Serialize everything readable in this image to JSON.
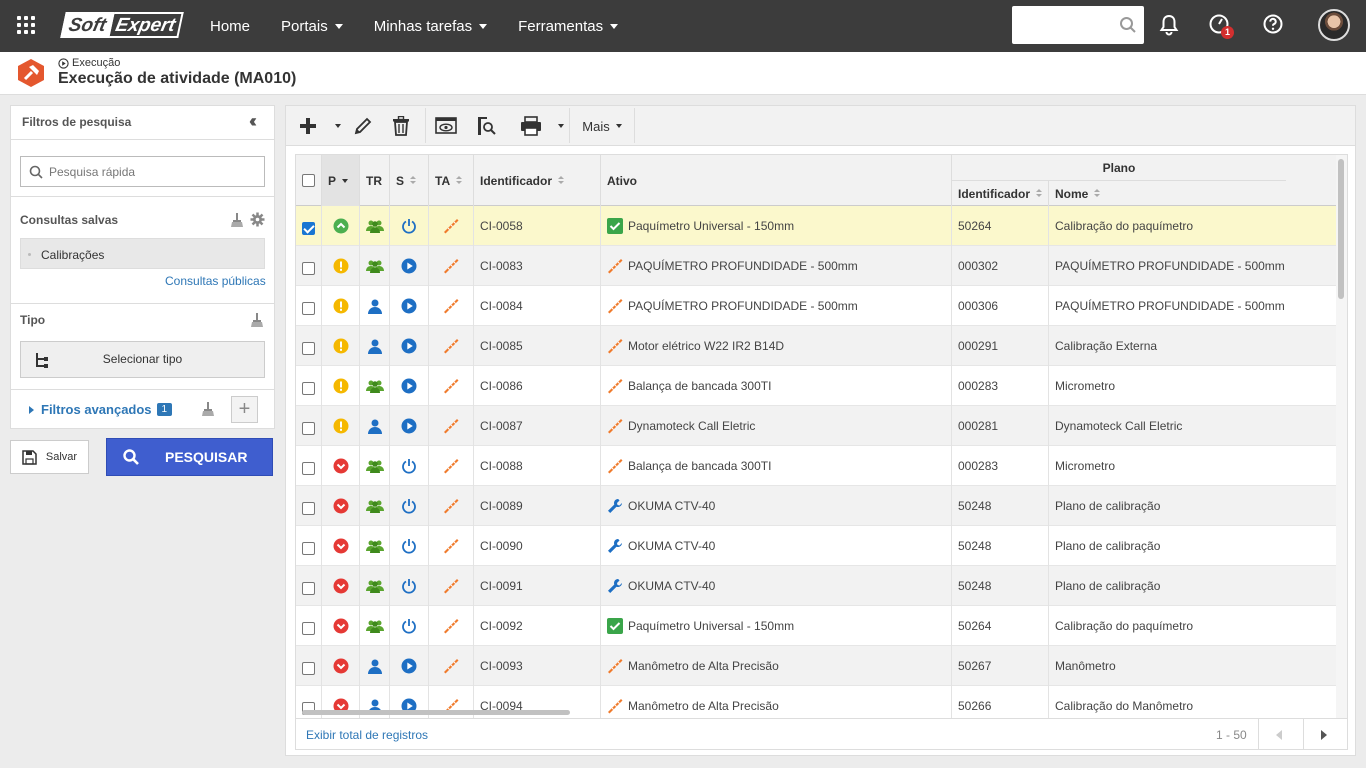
{
  "topbar": {
    "logo_part1": "Soft",
    "logo_part2": "Expert",
    "nav": [
      "Home",
      "Portais",
      "Minhas tarefas",
      "Ferramentas"
    ],
    "search_value": "",
    "notification_badge": "1"
  },
  "header": {
    "breadcrumb": "Execução",
    "title": "Execução de atividade (MA010)"
  },
  "filters": {
    "title": "Filtros de pesquisa",
    "quick_search_placeholder": "Pesquisa rápida",
    "saved_queries_title": "Consultas salvas",
    "saved_query": "Calibrações",
    "public_queries": "Consultas públicas",
    "type_title": "Tipo",
    "select_type": "Selecionar tipo",
    "advanced_filters": "Filtros avançados",
    "advanced_count": "1"
  },
  "actions": {
    "save": "Salvar",
    "search": "PESQUISAR"
  },
  "toolbar": {
    "more": "Mais"
  },
  "table": {
    "group_header": "Plano",
    "columns": [
      "P",
      "TR",
      "S",
      "TA",
      "Identificador",
      "Ativo",
      "Identificador",
      "Nome"
    ],
    "rows": [
      {
        "id": "CI-0058",
        "ativo": "Paquímetro Universal - 150mm",
        "plan_id": "50264",
        "plan_name": "Calibração do paquímetro",
        "priority": "up",
        "tr": "group",
        "s": "power",
        "asset": "check",
        "checked": true
      },
      {
        "id": "CI-0083",
        "ativo": "PAQUÍMETRO PROFUNDIDADE - 500mm",
        "plan_id": "000302",
        "plan_name": "PAQUÍMETRO PROFUNDIDADE - 500mm",
        "priority": "warn",
        "tr": "group",
        "s": "play",
        "asset": "ruler",
        "checked": false
      },
      {
        "id": "CI-0084",
        "ativo": "PAQUÍMETRO PROFUNDIDADE - 500mm",
        "plan_id": "000306",
        "plan_name": "PAQUÍMETRO PROFUNDIDADE - 500mm",
        "priority": "warn",
        "tr": "user",
        "s": "play",
        "asset": "ruler",
        "checked": false
      },
      {
        "id": "CI-0085",
        "ativo": "Motor elétrico  W22 IR2 B14D",
        "plan_id": "000291",
        "plan_name": "Calibração Externa",
        "priority": "warn",
        "tr": "user",
        "s": "play",
        "asset": "ruler",
        "checked": false
      },
      {
        "id": "CI-0086",
        "ativo": "Balança de bancada 300TI",
        "plan_id": "000283",
        "plan_name": "Micrometro",
        "priority": "warn",
        "tr": "group",
        "s": "play",
        "asset": "ruler",
        "checked": false
      },
      {
        "id": "CI-0087",
        "ativo": "Dynamoteck Call Eletric",
        "plan_id": "000281",
        "plan_name": "Dynamoteck Call Eletric",
        "priority": "warn",
        "tr": "user",
        "s": "play",
        "asset": "ruler",
        "checked": false
      },
      {
        "id": "CI-0088",
        "ativo": "Balança de bancada 300TI",
        "plan_id": "000283",
        "plan_name": "Micrometro",
        "priority": "down",
        "tr": "group",
        "s": "power",
        "asset": "ruler",
        "checked": false
      },
      {
        "id": "CI-0089",
        "ativo": "OKUMA CTV-40",
        "plan_id": "50248",
        "plan_name": "Plano de calibração",
        "priority": "down",
        "tr": "group",
        "s": "power",
        "asset": "wrench",
        "checked": false
      },
      {
        "id": "CI-0090",
        "ativo": "OKUMA CTV-40",
        "plan_id": "50248",
        "plan_name": "Plano de calibração",
        "priority": "down",
        "tr": "group",
        "s": "power",
        "asset": "wrench",
        "checked": false
      },
      {
        "id": "CI-0091",
        "ativo": "OKUMA CTV-40",
        "plan_id": "50248",
        "plan_name": "Plano de calibração",
        "priority": "down",
        "tr": "group",
        "s": "power",
        "asset": "wrench",
        "checked": false
      },
      {
        "id": "CI-0092",
        "ativo": "Paquímetro Universal - 150mm",
        "plan_id": "50264",
        "plan_name": "Calibração do paquímetro",
        "priority": "down",
        "tr": "group",
        "s": "power",
        "asset": "check",
        "checked": false
      },
      {
        "id": "CI-0093",
        "ativo": "Manômetro de Alta Precisão",
        "plan_id": "50267",
        "plan_name": "Manômetro",
        "priority": "down",
        "tr": "user",
        "s": "play",
        "asset": "ruler",
        "checked": false
      },
      {
        "id": "CI-0094",
        "ativo": "Manômetro de Alta Precisão",
        "plan_id": "50266",
        "plan_name": "Calibração do Manômetro",
        "priority": "down",
        "tr": "user",
        "s": "play",
        "asset": "ruler",
        "checked": false
      }
    ]
  },
  "footer": {
    "show_total": "Exibir total de registros",
    "range": "1 - 50"
  },
  "colors": {
    "topbar": "#3c3c3c",
    "primary": "#3f5ecf",
    "link": "#2e77b6",
    "selected_row": "#fbf8cc",
    "priority_up": "#4caf50",
    "priority_warn": "#f5b800",
    "priority_down": "#e53935",
    "status_blue": "#1e6fc4",
    "asset_orange": "#f07b2c"
  }
}
